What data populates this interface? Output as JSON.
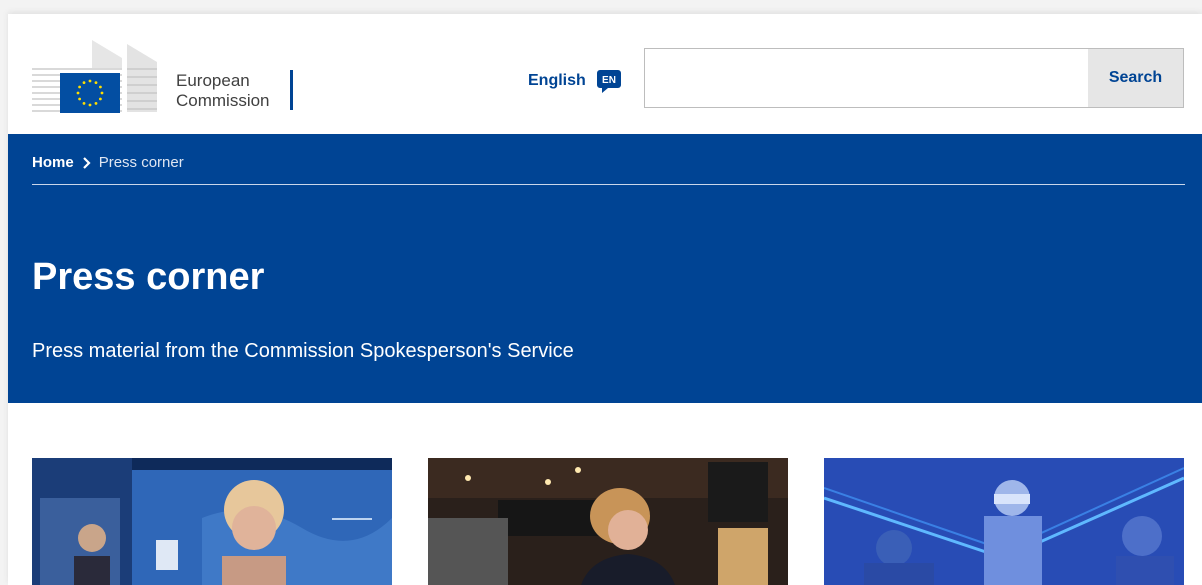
{
  "header": {
    "logo_text_line1": "European",
    "logo_text_line2": "Commission",
    "language": {
      "label": "English",
      "code": "EN"
    },
    "search": {
      "placeholder": "",
      "button_label": "Search"
    }
  },
  "breadcrumb": {
    "home": "Home",
    "current": "Press corner"
  },
  "banner": {
    "title": "Press corner",
    "subtitle": "Press material from the Commission Spokesperson's Service"
  },
  "colors": {
    "brand_blue": "#004494",
    "eu_flag_blue": "#034ea2",
    "eu_star_yellow": "#ffde00"
  },
  "cards": [
    {
      "image": "photo-speaker-global-goal-summit"
    },
    {
      "image": "photo-barista-coffee-shop"
    },
    {
      "image": "photo-health-workers-blue-overlay"
    }
  ]
}
